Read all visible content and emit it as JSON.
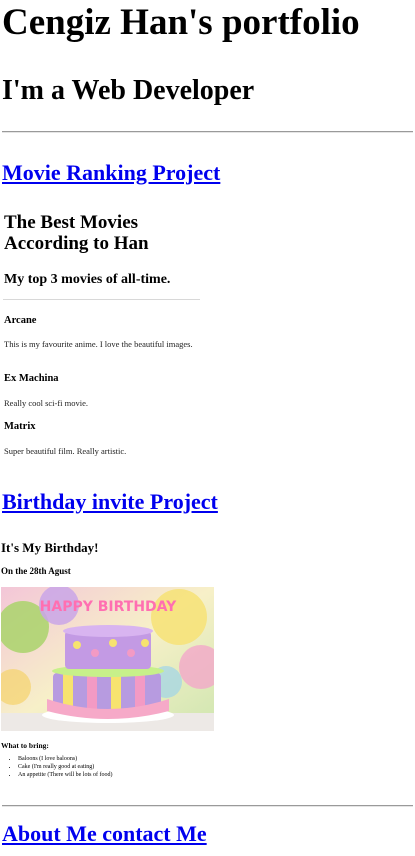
{
  "page": {
    "title": "Cengiz Han's portfolio",
    "subtitle": "I'm a Web Developer"
  },
  "projects": [
    {
      "link_text": "Movie Ranking Project"
    },
    {
      "link_text": "Birthday invite Project"
    }
  ],
  "movie_preview": {
    "heading": "The Best Movies According to Han",
    "subheading": "My top 3 movies of all-time.",
    "movies": [
      {
        "title": "Arcane",
        "description": "This is my favourite anime. I love the beautiful images."
      },
      {
        "title": "Ex Machina",
        "description": "Really cool sci-fi movie."
      },
      {
        "title": "Matrix",
        "description": "Super beautiful film. Really artistic."
      }
    ]
  },
  "birthday_preview": {
    "heading": "It's My Birthday!",
    "date": "On the 28th Agust",
    "image_text": "HAPPY BIRTHDAY",
    "bring_label": "What to bring:",
    "items": [
      "Baloons (I love baloons)",
      "Cake (I'm really good at eating)",
      "An appetite (There will be lots of food)"
    ]
  },
  "footer": {
    "link_text": "About Me contact Me"
  }
}
